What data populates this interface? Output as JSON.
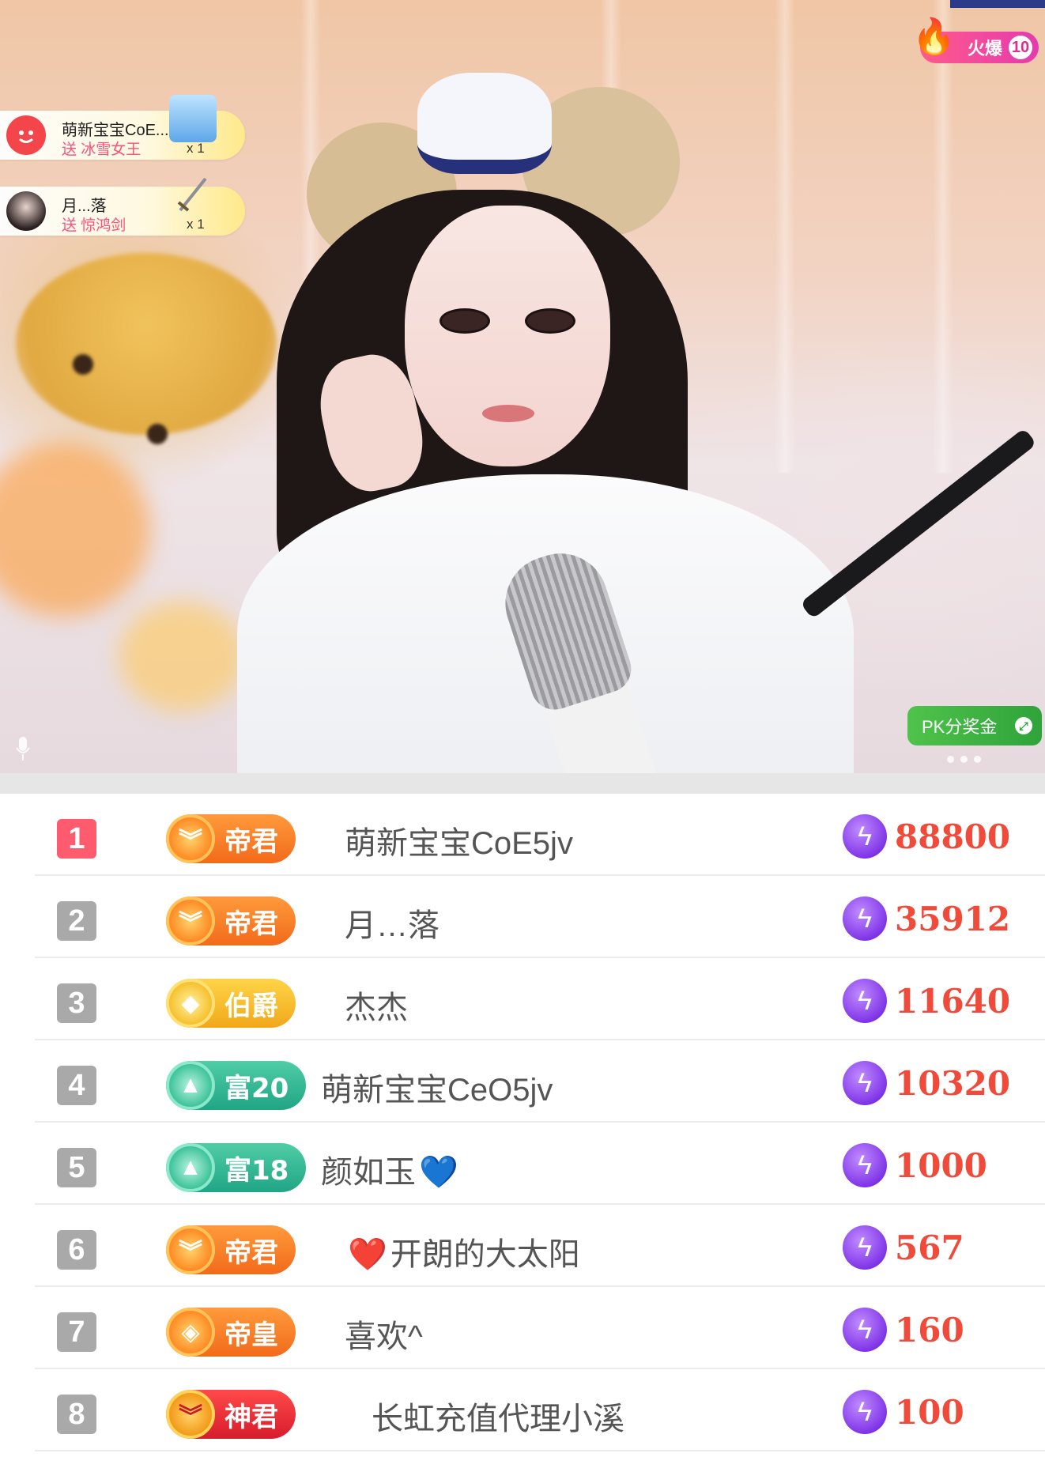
{
  "hot_badge": {
    "label": "火爆",
    "number": "10"
  },
  "gifts": [
    {
      "user": "萌新宝宝CoE...",
      "action": "送 冰雪女王",
      "count": "x 1",
      "avatar_icon": "red-smile-avatar"
    },
    {
      "user": "月...落",
      "action": "送 惊鸿剑",
      "count": "x 1",
      "avatar_icon": "girl-photo-avatar"
    }
  ],
  "pk_button": {
    "label": "PK分奖金"
  },
  "leaderboard": [
    {
      "rank": "1",
      "badge": "帝君",
      "badge_style": "orange",
      "emblem": "chevron-emblem",
      "name": "萌新宝宝CoE5jv",
      "score": "88800"
    },
    {
      "rank": "2",
      "badge": "帝君",
      "badge_style": "orange",
      "emblem": "chevron-emblem",
      "name": "月…落",
      "score": "35912"
    },
    {
      "rank": "3",
      "badge": "伯爵",
      "badge_style": "gold",
      "emblem": "diamond-emblem",
      "name": "杰杰",
      "score": "11640"
    },
    {
      "rank": "4",
      "badge": "富20",
      "badge_style": "teal",
      "emblem": "triangle-emblem",
      "name": "萌新宝宝CeO5jv",
      "score": "10320"
    },
    {
      "rank": "5",
      "badge": "富18",
      "badge_style": "teal",
      "emblem": "triangle-emblem",
      "name": "颜如玉",
      "name_suffix": "💙",
      "score": "1000"
    },
    {
      "rank": "6",
      "badge": "帝君",
      "badge_style": "orange",
      "emblem": "chevron-emblem",
      "name": "开朗的大太阳",
      "name_prefix": "❤️",
      "score": "567"
    },
    {
      "rank": "7",
      "badge": "帝皇",
      "badge_style": "orange",
      "emblem": "gem-emblem",
      "name": "喜欢^",
      "score": "160"
    },
    {
      "rank": "8",
      "badge": "神君",
      "badge_style": "red",
      "emblem": "chevron-emblem",
      "name": "长虹充值代理小溪",
      "score": "100"
    }
  ],
  "colors": {
    "score": "#f04b3a",
    "rank_first": "#ff5b6e",
    "rank_other": "#a9a9a9",
    "pk_green": "#2ea33a"
  }
}
